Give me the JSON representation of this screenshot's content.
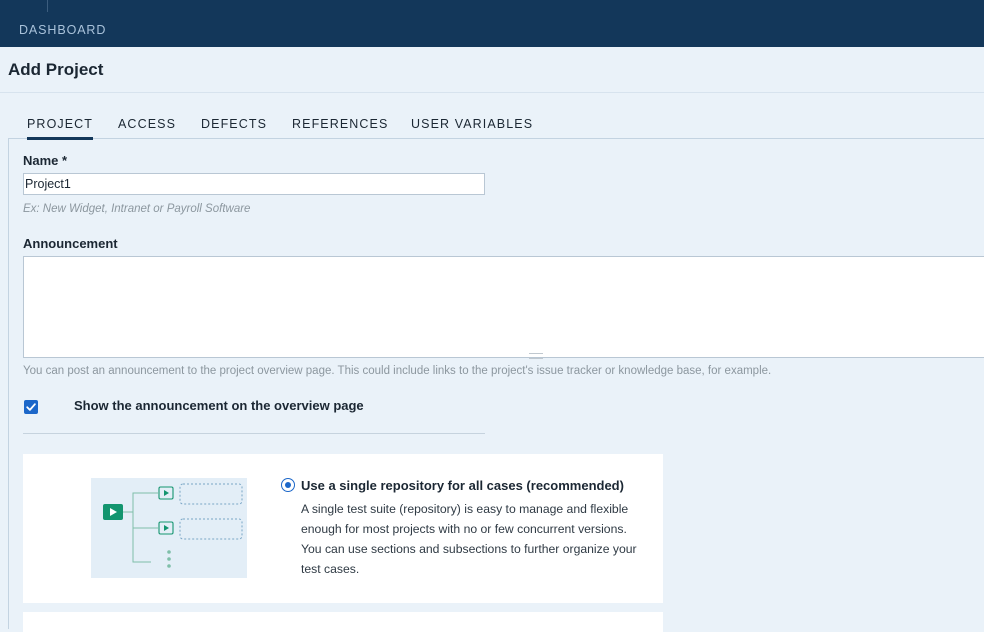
{
  "topbar": {
    "dashboard_label": "DASHBOARD"
  },
  "page": {
    "title": "Add Project"
  },
  "tabs": [
    {
      "label": "PROJECT",
      "active": true
    },
    {
      "label": "ACCESS",
      "active": false
    },
    {
      "label": "DEFECTS",
      "active": false
    },
    {
      "label": "REFERENCES",
      "active": false
    },
    {
      "label": "USER VARIABLES",
      "active": false
    }
  ],
  "form": {
    "name_label": "Name *",
    "name_value": "Project1",
    "name_hint": "Ex: New Widget, Intranet or Payroll Software",
    "announcement_label": "Announcement",
    "announcement_value": "",
    "announcement_hint": "You can post an announcement to the project overview page. This could include links to the project's issue tracker or knowledge base, for example.",
    "show_announcement_label": "Show the announcement on the overview page",
    "show_announcement_checked": true
  },
  "repository_options": [
    {
      "title": "Use a single repository for all cases (recommended)",
      "description": "A single test suite (repository) is easy to manage and flexible enough for most projects with no or few concurrent versions. You can use sections and subsections to further organize your test cases.",
      "selected": true,
      "illustration_icon": "folder-tree-icon"
    }
  ],
  "colors": {
    "topbar": "#13375a",
    "accent": "#1c67c9",
    "illustration_green": "#13956f"
  }
}
